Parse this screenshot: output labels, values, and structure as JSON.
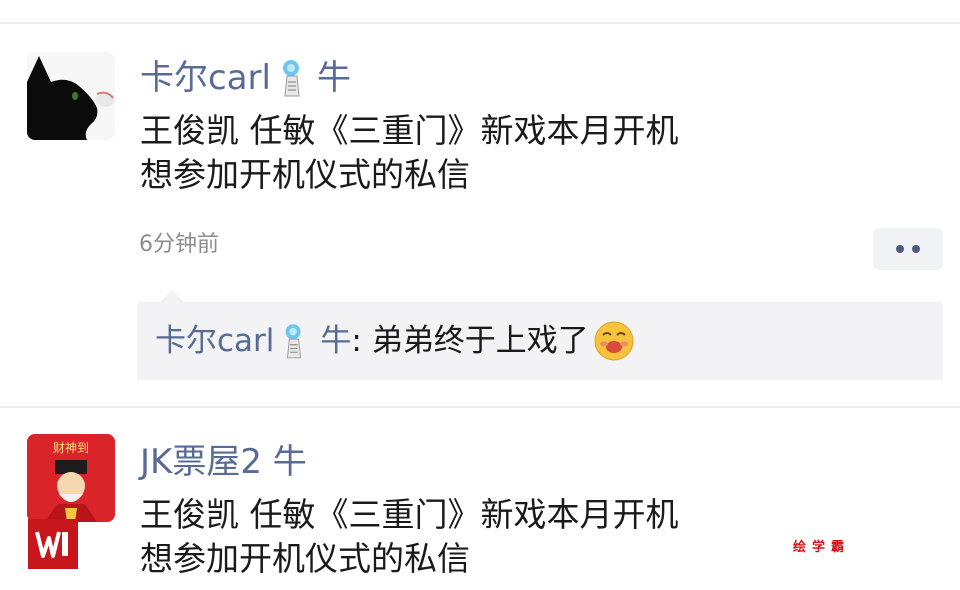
{
  "posts": [
    {
      "author": "卡尔carl",
      "author_suffix": "牛",
      "lines": [
        "王俊凯 任敏《三重门》新戏本月开机",
        "想参加开机仪式的私信"
      ],
      "timestamp": "6分钟前",
      "comment": {
        "author": "卡尔carl",
        "author_suffix": "牛",
        "text": ": 弟弟终于上戏了"
      }
    },
    {
      "author": "JK票屋2 牛",
      "lines": [
        "王俊凯 任敏《三重门》新戏本月开机",
        "想参加开机仪式的私信"
      ]
    }
  ],
  "avatar_text": "财神到",
  "watermark": "绘学霸",
  "icons": [
    "bell-icon",
    "smiling-face-emoji-icon",
    "more-dots-icon"
  ],
  "colors": {
    "name": "#576b95",
    "comment_bg": "#f3f3f5",
    "divider": "#ececec",
    "watermark": "#d4141a"
  }
}
